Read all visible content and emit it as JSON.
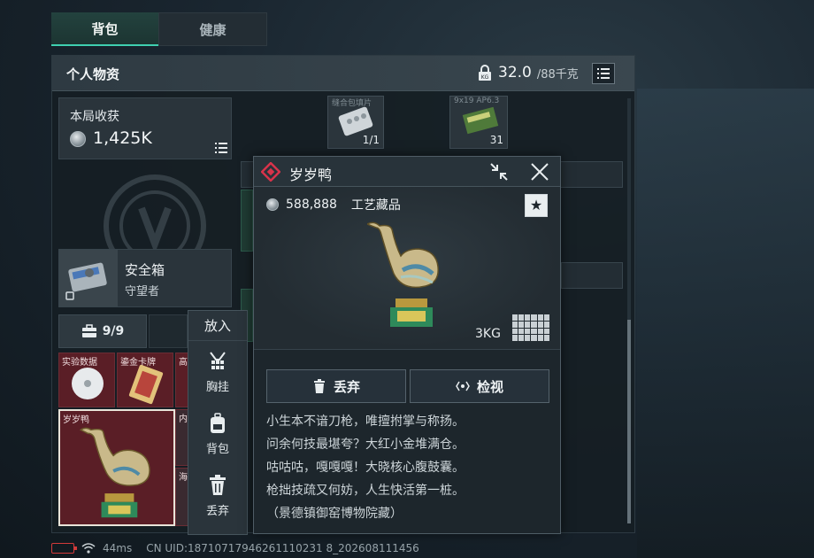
{
  "tabs": [
    {
      "label": "背包",
      "active": true
    },
    {
      "label": "健康",
      "active": false
    }
  ],
  "panel": {
    "title": "个人物资",
    "weight_current": "32.0",
    "weight_max": "/88千克",
    "lock_badge": "KG"
  },
  "earnings": {
    "label": "本局收获",
    "value": "1,425K"
  },
  "safe_box": {
    "name": "安全箱",
    "subtitle": "守望者"
  },
  "backpack": {
    "capacity": "9/9",
    "items": [
      {
        "label": "实验数据"
      },
      {
        "label": "鎏金卡牌"
      },
      {
        "label": "高"
      },
      {
        "label": "岁岁鸭"
      },
      {
        "label": "内"
      },
      {
        "label": "海"
      }
    ]
  },
  "context_menu": {
    "title": "放入",
    "items": [
      {
        "label": "胸挂",
        "icon": "vest-icon"
      },
      {
        "label": "背包",
        "icon": "backpack-icon"
      },
      {
        "label": "丢弃",
        "icon": "trash-icon"
      }
    ]
  },
  "background_slots": [
    {
      "label": "缝合包填片",
      "count": "1/1"
    },
    {
      "label": "9x19 AP6.3",
      "count": "31"
    }
  ],
  "detail": {
    "name": "岁岁鸭",
    "price": "588,888",
    "category": "工艺藏品",
    "weight": "3KG",
    "drop_label": "丢弃",
    "inspect_label": "检视",
    "star": "★",
    "description": [
      "小生本不谙刀枪，唯擅拊掌与称扬。",
      "问余何技最堪夸？大红小金堆满仓。",
      "咕咕咕，嘎嘎嘎！大晓核心腹鼓囊。",
      "枪拙技疏又何妨，人生快活第一桩。",
      "（景德镇御窑博物院藏）"
    ]
  },
  "footer": {
    "ping": "44ms",
    "uid": "CN UID:18710717946261110231 8_202608111456"
  },
  "colors": {
    "accent": "#3fd0b0",
    "rarity_red": "#d8334a",
    "battery_low": "#d23a3a"
  }
}
